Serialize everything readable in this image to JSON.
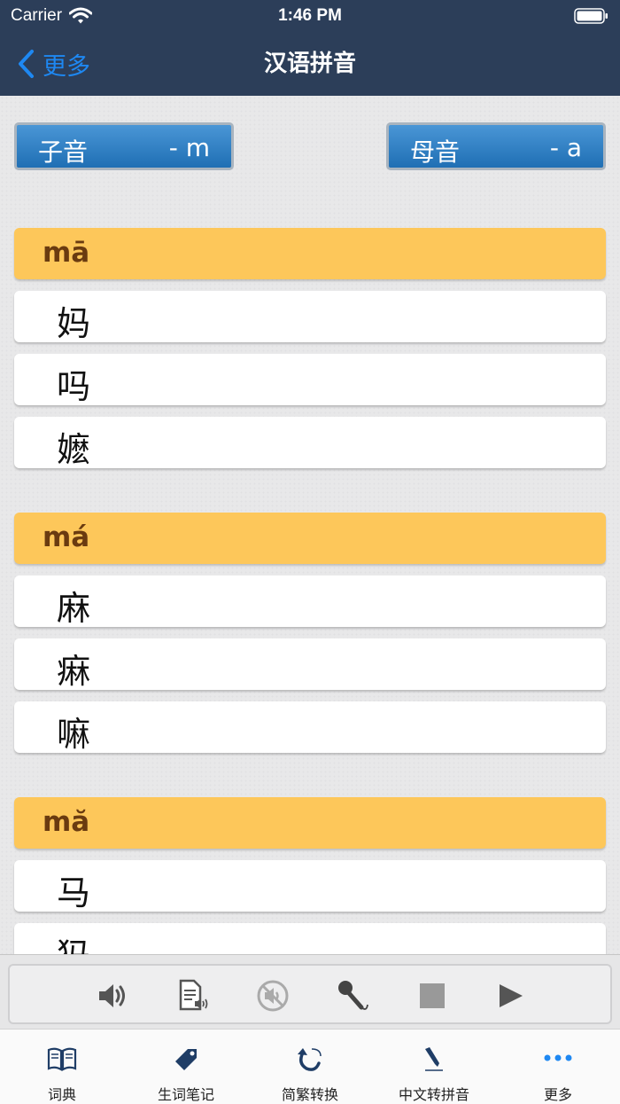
{
  "status_bar": {
    "carrier": "Carrier",
    "time": "1:46 PM"
  },
  "nav": {
    "back_label": "更多",
    "title": "汉语拼音"
  },
  "selectors": {
    "initial": {
      "label": "子音",
      "value": "- m"
    },
    "final": {
      "label": "母音",
      "value": "- a"
    }
  },
  "sections": [
    {
      "pinyin": "mā",
      "chars": [
        "妈",
        "吗",
        "嬷"
      ]
    },
    {
      "pinyin": "má",
      "chars": [
        "麻",
        "痳",
        "嘛"
      ]
    },
    {
      "pinyin": "mă",
      "chars": [
        "马",
        "犸"
      ]
    }
  ],
  "player": {
    "buttons": [
      "speaker-icon",
      "read-document-icon",
      "mute-icon",
      "microphone-icon",
      "stop-icon",
      "play-icon"
    ]
  },
  "tabs": [
    {
      "label": "词典",
      "icon": "book-icon"
    },
    {
      "label": "生词笔记",
      "icon": "tag-icon"
    },
    {
      "label": "简繁转换",
      "icon": "convert-arrow-icon"
    },
    {
      "label": "中文转拼音",
      "icon": "pen-icon"
    },
    {
      "label": "更多",
      "icon": "more-dots-icon",
      "active": true
    }
  ],
  "colors": {
    "nav_bg": "#2c3e59",
    "accent": "#1e88f2",
    "section_header": "#fdc75a",
    "selector_blue": "#1f6fb4"
  }
}
